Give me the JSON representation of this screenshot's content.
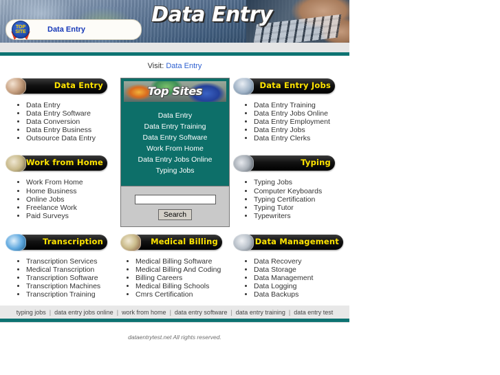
{
  "header": {
    "banner_title": "Data Entry",
    "logo_badge_line1": "TOP",
    "logo_badge_line2": "SITE",
    "logo_text": "Data Entry"
  },
  "visit": {
    "label": "Visit:",
    "link": "Data Entry"
  },
  "sections": [
    {
      "title": "Data Entry",
      "thumb": "hands-icon",
      "thumb_class": "th-hands",
      "links": [
        "Data Entry",
        "Data Entry Software",
        "Data Conversion",
        "Data Entry Business",
        "Outsource Data Entry"
      ]
    },
    {
      "title": "Work from Home",
      "thumb": "money-icon",
      "thumb_class": "th-money",
      "links": [
        "Work From Home",
        "Home Business",
        "Online Jobs",
        "Freelance Work",
        "Paid Surveys"
      ]
    },
    {
      "title": "Data Entry Jobs",
      "thumb": "people-icon",
      "thumb_class": "th-people",
      "links": [
        "Data Entry Training",
        "Data Entry Jobs Online",
        "Data Entry Employment",
        "Data Entry Jobs",
        "Data Entry Clerks"
      ]
    },
    {
      "title": "Typing",
      "thumb": "keyboard-icon",
      "thumb_class": "th-keyboard",
      "links": [
        "Typing Jobs",
        "Computer Keyboards",
        "Typing Certification",
        "Typing Tutor",
        "Typewriters"
      ]
    },
    {
      "title": "Transcription",
      "thumb": "tape-icon",
      "thumb_class": "th-tape",
      "links": [
        "Transcription Services",
        "Medical Transcription",
        "Transcription Software",
        "Transcription Machines",
        "Transcription Training"
      ]
    },
    {
      "title": "Medical Billing",
      "thumb": "medical-icon",
      "thumb_class": "th-medical",
      "links": [
        "Medical Billing Software",
        "Medical Billing And Coding",
        "Billing Careers",
        "Medical Billing Schools",
        "Cmrs Certification"
      ]
    },
    {
      "title": "Data Management",
      "thumb": "monitor-icon",
      "thumb_class": "th-monitor",
      "links": [
        "Data Recovery",
        "Data Storage",
        "Data Management",
        "Data Logging",
        "Data Backups"
      ]
    }
  ],
  "topsites": {
    "header_title": "Top Sites",
    "links": [
      "Data Entry",
      "Data Entry Training",
      "Data Entry Software",
      "Work From Home",
      "Data Entry Jobs Online",
      "Typing Jobs"
    ],
    "search_value": "",
    "search_placeholder": "",
    "search_button": "Search"
  },
  "footer": {
    "links": [
      "typing jobs",
      "data entry jobs online",
      "work from home",
      "data entry software",
      "data entry training",
      "data entry test"
    ],
    "separator": "|",
    "copyright": "dataentrytest.net All rights reserved."
  },
  "colors": {
    "teal": "#0d7372",
    "box_teal": "#0d6f69",
    "banner_yellow": "#ffe400",
    "link_blue": "#2c5fd0"
  }
}
